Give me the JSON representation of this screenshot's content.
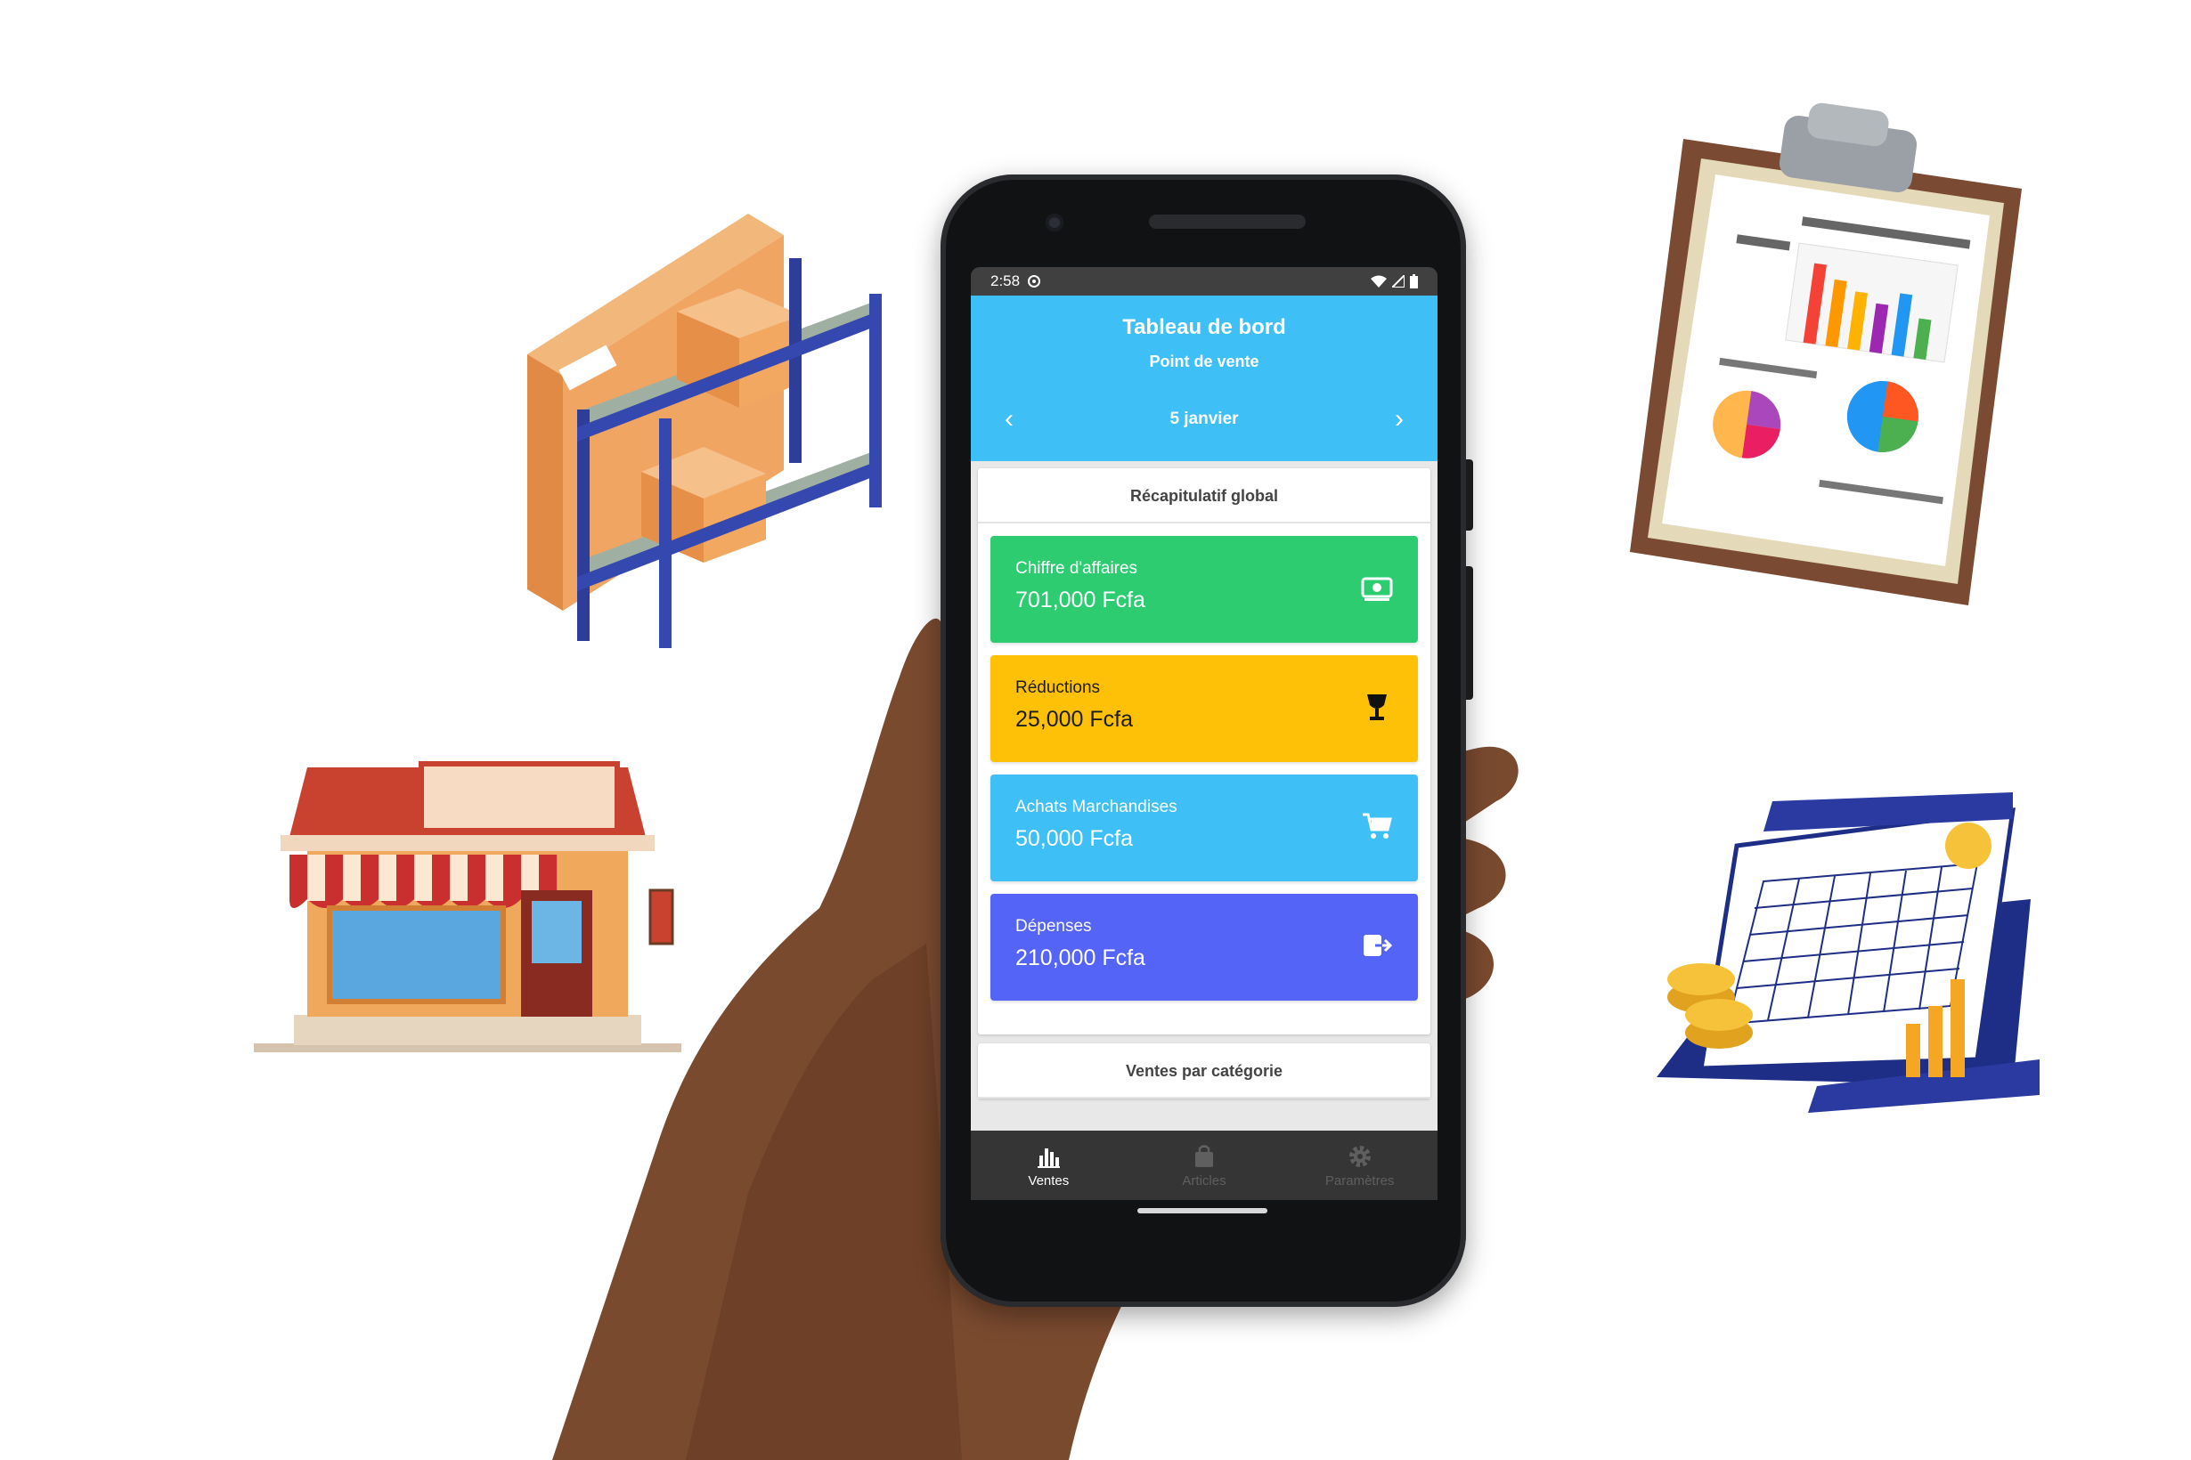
{
  "status_bar": {
    "time": "2:58"
  },
  "header": {
    "title": "Tableau de bord",
    "subtitle": "Point de vente"
  },
  "date_nav": {
    "date": "5 janvier",
    "prev_icon": "chevron-left-icon",
    "next_icon": "chevron-right-icon"
  },
  "summary": {
    "title": "Récapitulatif global",
    "stats": [
      {
        "label": "Chiffre d'affaires",
        "value": "701,000 Fcfa",
        "color": "#2ecc71",
        "icon": "money-icon"
      },
      {
        "label": "Réductions",
        "value": "25,000 Fcfa",
        "color": "#ffc107",
        "icon": "glass-icon"
      },
      {
        "label": "Achats Marchandises",
        "value": "50,000 Fcfa",
        "color": "#3ebff6",
        "icon": "cart-icon"
      },
      {
        "label": "Dépenses",
        "value": "210,000 Fcfa",
        "color": "#5464f7",
        "icon": "exit-icon"
      }
    ]
  },
  "category_section": {
    "title": "Ventes par catégorie"
  },
  "bottom_nav": {
    "tabs": [
      {
        "label": "Ventes",
        "icon": "bar-chart-icon",
        "active": true
      },
      {
        "label": "Articles",
        "icon": "bag-icon",
        "active": false
      },
      {
        "label": "Paramètres",
        "icon": "gear-icon",
        "active": false
      }
    ]
  },
  "colors": {
    "header": "#3ebff6",
    "nav_bg": "#353535",
    "status_bg": "#404040"
  }
}
